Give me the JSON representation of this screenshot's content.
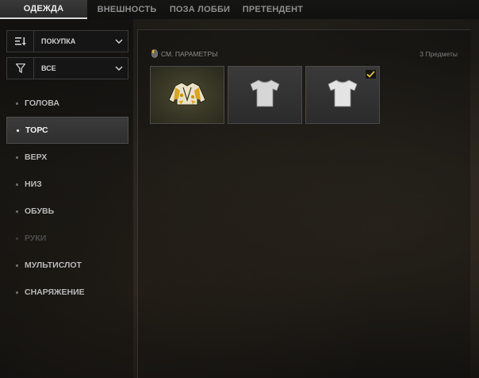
{
  "tabs": [
    {
      "label": "ОДЕЖДА",
      "active": true
    },
    {
      "label": "ВНЕШНОСТЬ",
      "active": false
    },
    {
      "label": "ПОЗА ЛОББИ",
      "active": false
    },
    {
      "label": "ПРЕТЕНДЕНТ",
      "active": false
    }
  ],
  "sort_dropdown": {
    "label": "ПОКУПКА",
    "icon": "sort-icon"
  },
  "filter_dropdown": {
    "label": "ВСЕ",
    "icon": "filter-icon"
  },
  "categories": [
    {
      "label": "ГОЛОВА",
      "state": "normal"
    },
    {
      "label": "ТОРС",
      "state": "active"
    },
    {
      "label": "ВЕРХ",
      "state": "normal"
    },
    {
      "label": "НИЗ",
      "state": "normal"
    },
    {
      "label": "ОБУВЬ",
      "state": "normal"
    },
    {
      "label": "РУКИ",
      "state": "disabled"
    },
    {
      "label": "МУЛЬТИСЛОТ",
      "state": "normal"
    },
    {
      "label": "СНАРЯЖЕНИЕ",
      "state": "normal"
    }
  ],
  "main": {
    "params_label": "СМ. ПАРАМЕТРЫ",
    "params_icon": "mouse-icon",
    "count_label": "3 Предметы"
  },
  "items": [
    {
      "name": "yellow-floral-jacket",
      "equipped": false
    },
    {
      "name": "white-tshirt",
      "equipped": false
    },
    {
      "name": "white-tshirt",
      "equipped": true
    }
  ],
  "colors": {
    "check": "#e0c43a",
    "active_tab_underline": "#d7d7d7"
  }
}
